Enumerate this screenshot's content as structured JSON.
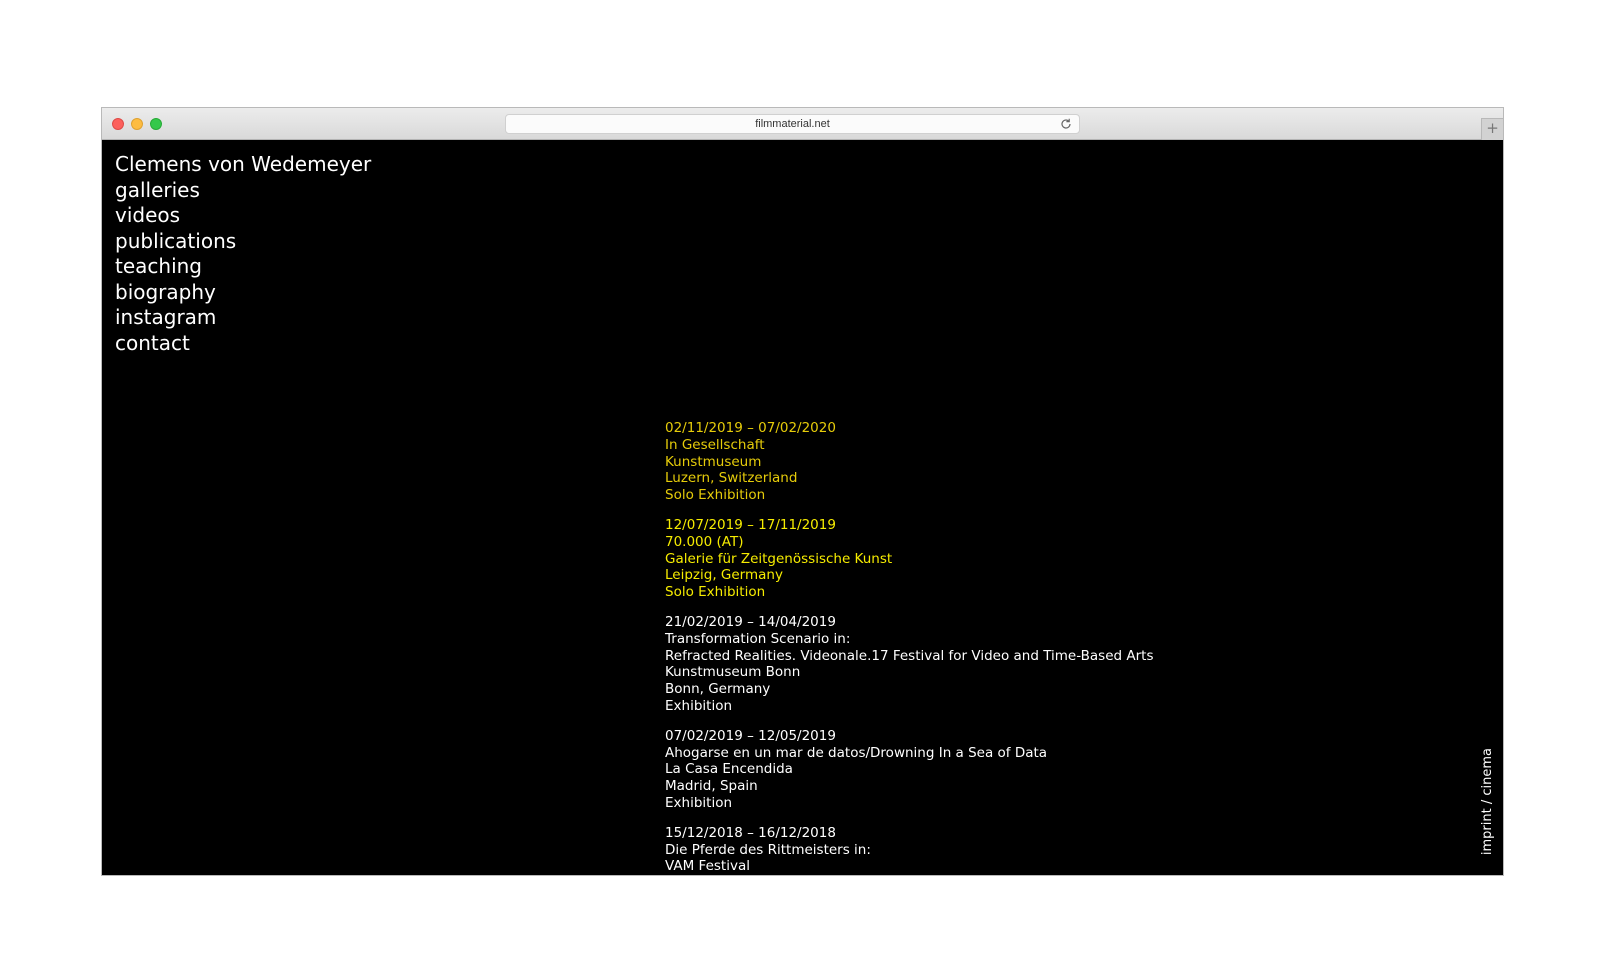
{
  "browser": {
    "url": "filmmaterial.net",
    "new_tab_label": "+"
  },
  "nav": {
    "site_title": "Clemens von Wedemeyer",
    "items": [
      "galleries",
      "videos",
      "publications",
      "teaching",
      "biography",
      "instagram",
      "contact"
    ]
  },
  "events": [
    {
      "dates": "02/11/2019 – 07/02/2020",
      "lines": [
        "In Gesellschaft",
        "Kunstmuseum",
        "Luzern, Switzerland",
        "Solo Exhibition"
      ]
    },
    {
      "dates": "12/07/2019 – 17/11/2019",
      "lines": [
        "70.000 (AT)",
        "Galerie für Zeitgenössische Kunst",
        "Leipzig, Germany",
        "Solo Exhibition"
      ]
    },
    {
      "dates": "21/02/2019 – 14/04/2019",
      "lines": [
        "Transformation Scenario in:",
        "Refracted Realities. Videonale.17 Festival for Video and Time-Based Arts",
        "Kunstmuseum Bonn",
        "Bonn, Germany",
        "Exhibition"
      ]
    },
    {
      "dates": "07/02/2019 – 12/05/2019",
      "lines": [
        "Ahogarse en un mar de datos/Drowning In a Sea of Data",
        "La Casa Encendida",
        "Madrid, Spain",
        "Exhibition"
      ]
    },
    {
      "dates": "15/12/2018 – 16/12/2018",
      "lines": [
        "Die Pferde des Rittmeisters in:",
        "VAM Festival"
      ]
    }
  ],
  "footer_links": {
    "imprint": "imprint",
    "separator": " / ",
    "cinema": "cinema"
  },
  "colors": {
    "background": "#000000",
    "text": "#ffffff",
    "highlight_current": "#f6ec00",
    "highlight_ongoing": "#e6cc0a"
  }
}
